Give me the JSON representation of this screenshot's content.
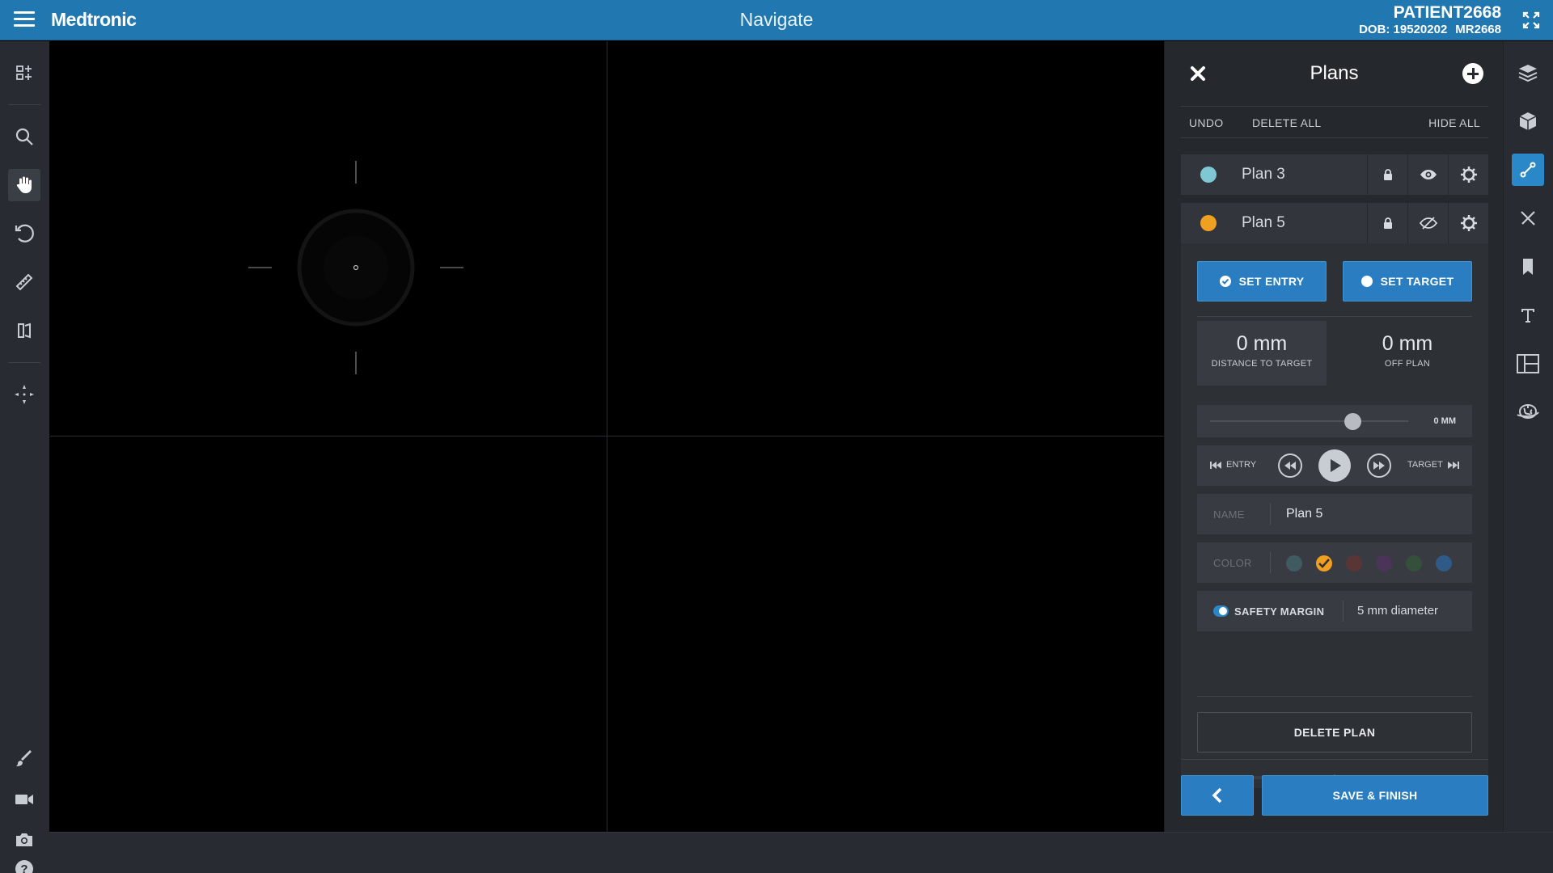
{
  "header": {
    "brand": "Medtronic",
    "title": "Navigate",
    "patient_name": "PATIENT2668",
    "dob": "DOB: 19520202",
    "mrn": "MR2668"
  },
  "colors": {
    "header_blue": "#2178b0",
    "accent_blue": "#2a7dc0",
    "plan3_color": "#7ec8d4",
    "plan5_color": "#f0a020"
  },
  "left_toolbar": {
    "items": [
      "layout-icon",
      "search-icon",
      "pan-hand-icon",
      "rotate-icon",
      "ruler-icon",
      "flip-icon",
      "center-icon",
      "brush-icon",
      "video-icon",
      "camera-icon",
      "help-icon"
    ],
    "active": "pan-hand-icon"
  },
  "right_toolbar": {
    "items": [
      "layers-icon",
      "cube-icon",
      "trajectory-icon",
      "tools-icon",
      "bookmark-icon",
      "text-icon",
      "layout-icon",
      "brain-icon"
    ],
    "active": "trajectory-icon"
  },
  "panel": {
    "title": "Plans",
    "undo": "UNDO",
    "delete_all": "DELETE ALL",
    "hide_all": "HIDE ALL",
    "plans": [
      {
        "name": "Plan 3",
        "color": "#7ec8d4",
        "visible": true
      },
      {
        "name": "Plan 5",
        "color": "#f0a020",
        "visible": false
      }
    ],
    "set_entry": "SET ENTRY",
    "set_target": "SET TARGET",
    "distance_value": "0 mm",
    "distance_label": "DISTANCE TO TARGET",
    "offplan_value": "0 mm",
    "offplan_label": "OFF PLAN",
    "slider_value": "0 MM",
    "slider_position": 0.72,
    "entry_label": "ENTRY",
    "target_label": "TARGET",
    "name_label": "NAME",
    "name_value": "Plan 5",
    "color_label": "COLOR",
    "swatches": [
      "#3f5a60",
      "#f0a020",
      "#5a3535",
      "#4a3458",
      "#35503a",
      "#2f5a88"
    ],
    "selected_swatch": 1,
    "safety_label": "SAFETY MARGIN",
    "safety_value": "5 mm diameter",
    "delete_plan": "DELETE PLAN",
    "save_finish": "SAVE & FINISH"
  }
}
